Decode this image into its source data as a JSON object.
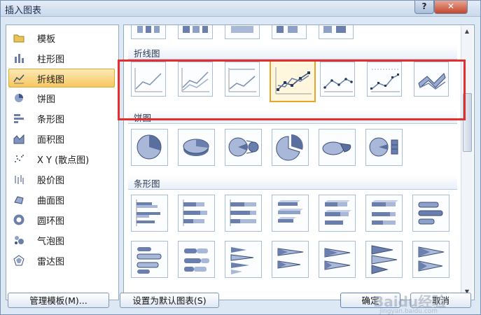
{
  "window": {
    "title": "插入图表",
    "help_label": "?",
    "close_label": "✕"
  },
  "sidebar": {
    "items": [
      {
        "label": "模板",
        "icon": "folder-icon"
      },
      {
        "label": "柱形图",
        "icon": "column-chart-icon"
      },
      {
        "label": "折线图",
        "icon": "line-chart-icon",
        "selected": true
      },
      {
        "label": "饼图",
        "icon": "pie-chart-icon"
      },
      {
        "label": "条形图",
        "icon": "bar-chart-icon"
      },
      {
        "label": "面积图",
        "icon": "area-chart-icon"
      },
      {
        "label": "X Y (散点图)",
        "icon": "scatter-chart-icon"
      },
      {
        "label": "股价图",
        "icon": "stock-chart-icon"
      },
      {
        "label": "曲面图",
        "icon": "surface-chart-icon"
      },
      {
        "label": "圆环图",
        "icon": "doughnut-chart-icon"
      },
      {
        "label": "气泡图",
        "icon": "bubble-chart-icon"
      },
      {
        "label": "雷达图",
        "icon": "radar-chart-icon"
      }
    ]
  },
  "gallery": {
    "sections": [
      {
        "label": "折线图",
        "thumb_count": 7,
        "selected_index": 3
      },
      {
        "label": "饼图",
        "thumb_count": 6
      },
      {
        "label": "条形图",
        "thumb_count": 14
      }
    ]
  },
  "buttons": {
    "manage_templates": "管理模板(M)...",
    "set_default": "设置为默认图表(S)",
    "ok": "确定",
    "cancel": "取消"
  },
  "watermark": {
    "text": "Baidu经验",
    "subtext": "jingyan.baidu.com"
  },
  "colors": {
    "selection": "#f6c760",
    "highlight_box": "#e52e2e",
    "thumb_border": "#a9bdd8"
  }
}
